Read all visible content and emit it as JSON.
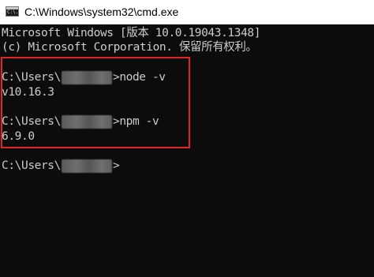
{
  "window": {
    "title": "C:\\Windows\\system32\\cmd.exe",
    "icon_name": "cmd-icon",
    "icon_text": "C:\\."
  },
  "console": {
    "banner_line1": "Microsoft Windows [版本 10.0.19043.1348]",
    "banner_line2": "(c) Microsoft Corporation. 保留所有权利。",
    "prompt_prefix": "C:\\Users\\",
    "prompt_suffix": ">",
    "commands": [
      {
        "command": "node -v",
        "output": "v10.16.3"
      },
      {
        "command": "npm -v",
        "output": "6.9.0"
      }
    ],
    "final_prompt_suffix": ">"
  },
  "highlight": {
    "color": "#e1262a"
  },
  "colors": {
    "console_background": "#0c0c0c",
    "console_text": "#cccccc",
    "titlebar_background": "#ffffff"
  }
}
